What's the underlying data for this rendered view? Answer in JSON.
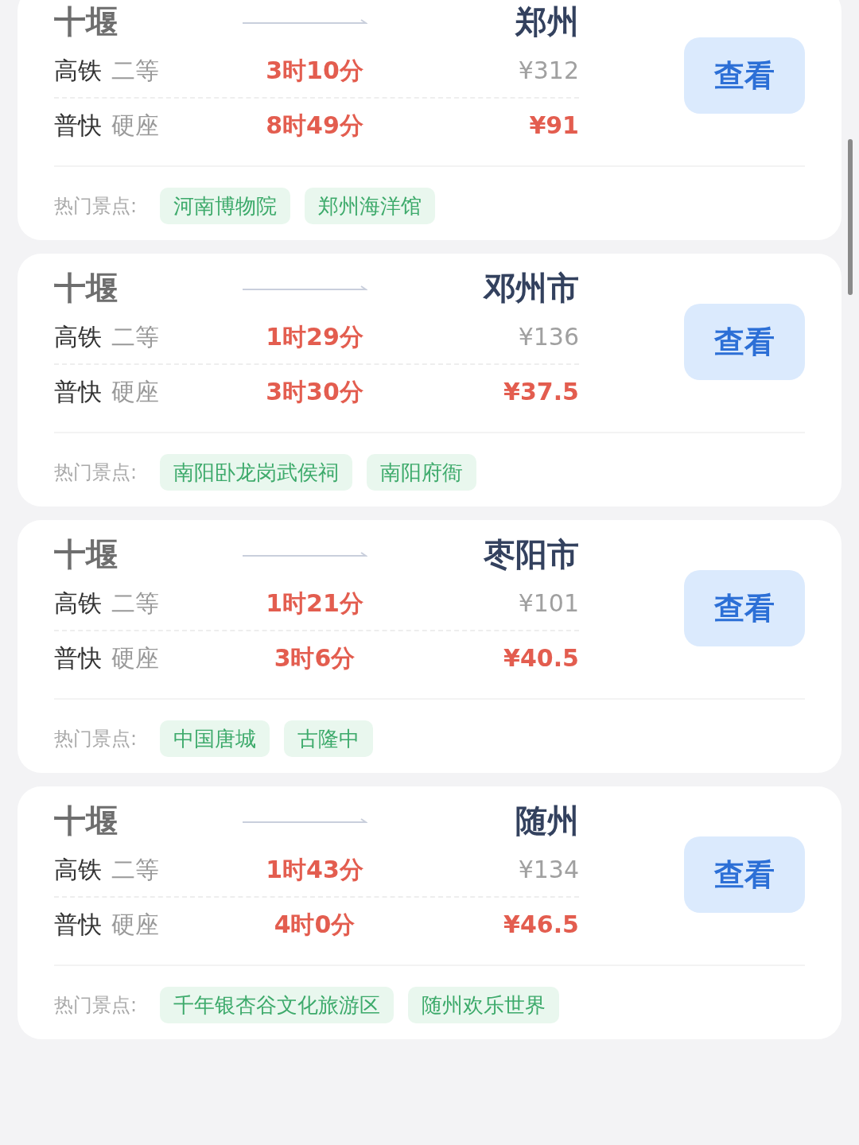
{
  "routes": [
    {
      "origin": "十堰",
      "destination": "郑州",
      "options": [
        {
          "train": "高铁",
          "seat": "二等",
          "duration": "3时10分",
          "price": "¥312",
          "cheapest": false
        },
        {
          "train": "普快",
          "seat": "硬座",
          "duration": "8时49分",
          "price": "¥91",
          "cheapest": true
        }
      ],
      "button": "查看",
      "spots_label": "热门景点:",
      "spots": [
        "河南博物院",
        "郑州海洋馆"
      ]
    },
    {
      "origin": "十堰",
      "destination": "邓州市",
      "options": [
        {
          "train": "高铁",
          "seat": "二等",
          "duration": "1时29分",
          "price": "¥136",
          "cheapest": false
        },
        {
          "train": "普快",
          "seat": "硬座",
          "duration": "3时30分",
          "price": "¥37.5",
          "cheapest": true
        }
      ],
      "button": "查看",
      "spots_label": "热门景点:",
      "spots": [
        "南阳卧龙岗武侯祠",
        "南阳府衙"
      ]
    },
    {
      "origin": "十堰",
      "destination": "枣阳市",
      "options": [
        {
          "train": "高铁",
          "seat": "二等",
          "duration": "1时21分",
          "price": "¥101",
          "cheapest": false
        },
        {
          "train": "普快",
          "seat": "硬座",
          "duration": "3时6分",
          "price": "¥40.5",
          "cheapest": true
        }
      ],
      "button": "查看",
      "spots_label": "热门景点:",
      "spots": [
        "中国唐城",
        "古隆中"
      ]
    },
    {
      "origin": "十堰",
      "destination": "随州",
      "options": [
        {
          "train": "高铁",
          "seat": "二等",
          "duration": "1时43分",
          "price": "¥134",
          "cheapest": false
        },
        {
          "train": "普快",
          "seat": "硬座",
          "duration": "4时0分",
          "price": "¥46.5",
          "cheapest": true
        }
      ],
      "button": "查看",
      "spots_label": "热门景点:",
      "spots": [
        "千年银杏谷文化旅游区",
        "随州欢乐世界"
      ]
    }
  ]
}
